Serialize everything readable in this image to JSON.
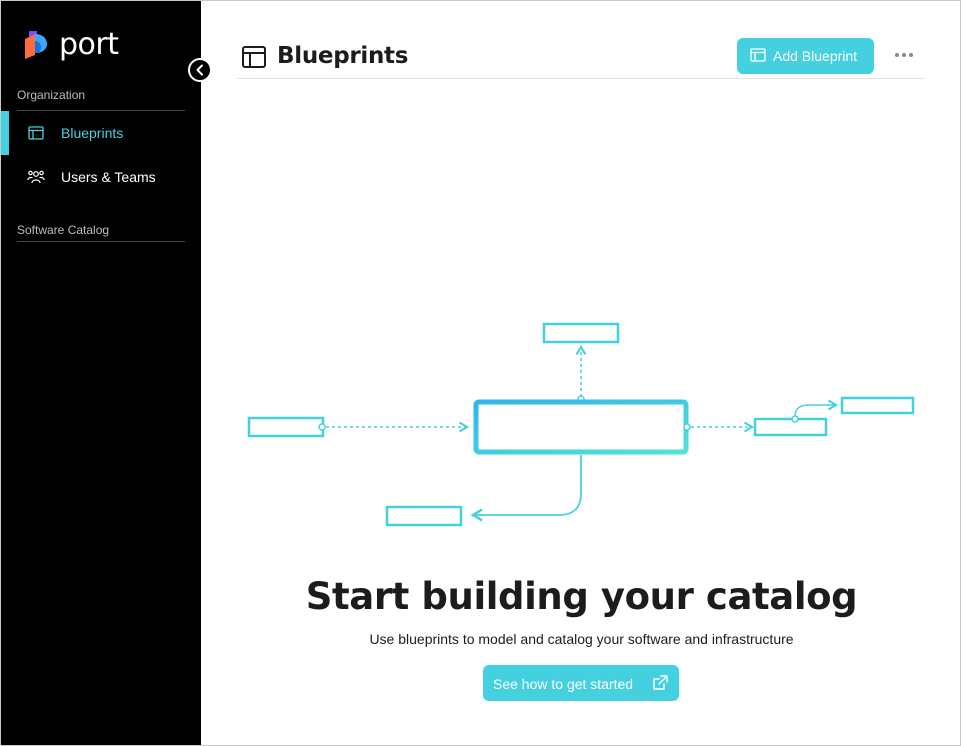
{
  "app": {
    "name": "port"
  },
  "sidebar": {
    "sections": [
      {
        "label": "Organization"
      },
      {
        "label": "Software Catalog"
      }
    ],
    "items": [
      {
        "label": "Blueprints",
        "icon": "blueprint-icon",
        "active": true
      },
      {
        "label": "Users & Teams",
        "icon": "users-teams-icon",
        "active": false
      }
    ],
    "collapse_icon": "chevron-left-icon"
  },
  "header": {
    "title": "Blueprints",
    "icon": "blueprint-icon",
    "add_button_label": "Add Blueprint",
    "more_icon": "more-horizontal-icon"
  },
  "empty_state": {
    "title": "Start building your catalog",
    "subtitle": "Use blueprints to model and catalog your software and infrastructure",
    "cta_label": "See how to get started",
    "cta_icon": "external-link-icon"
  },
  "colors": {
    "accent": "#45d0e0",
    "sidebar_bg": "#000000",
    "text": "#1c1c1c"
  }
}
